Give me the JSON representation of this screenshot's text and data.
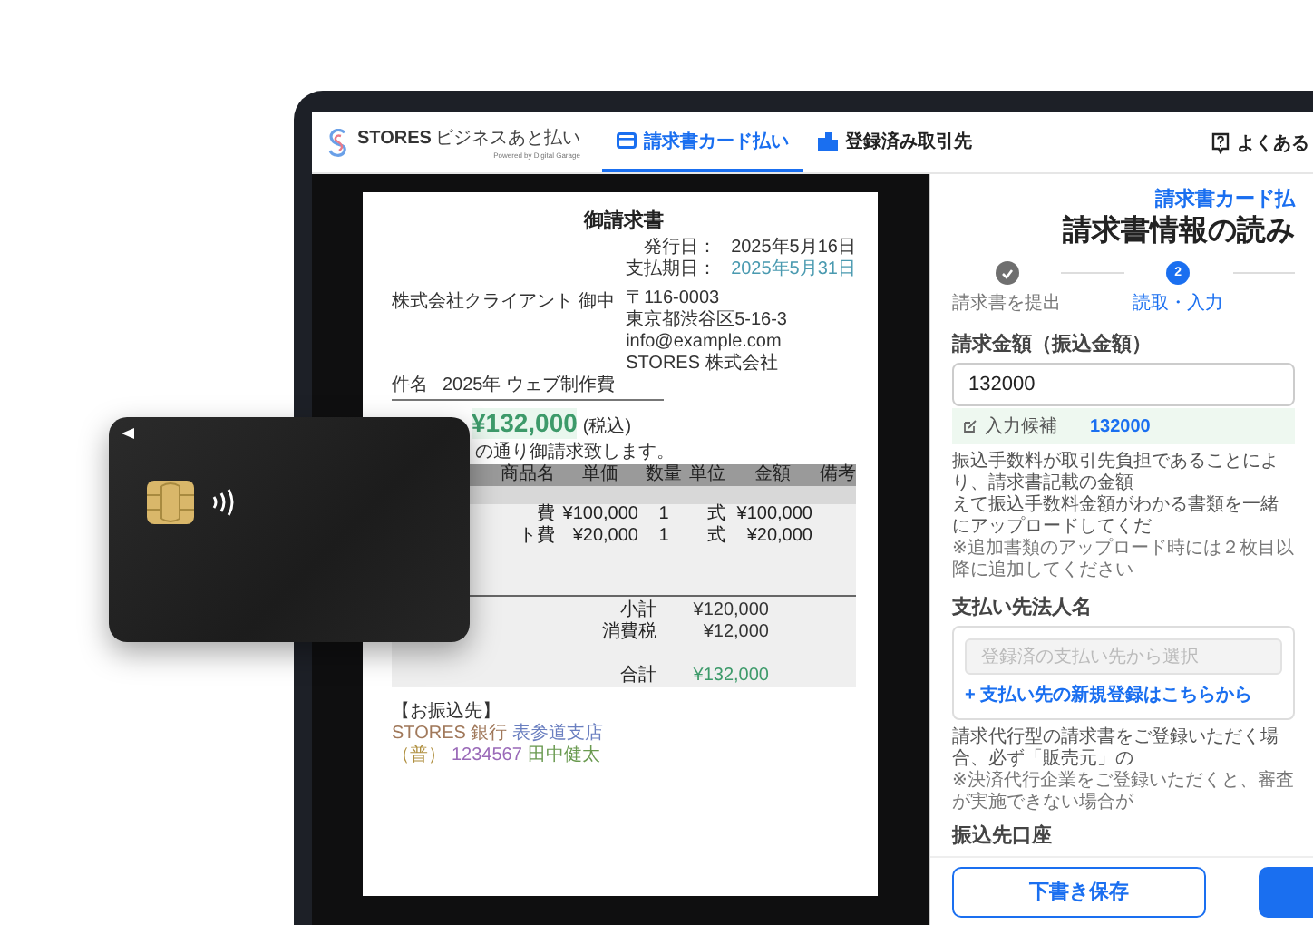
{
  "header": {
    "logo": {
      "brand": "STORES",
      "product": "ビジネスあと払い",
      "tagline": "Powered by Digital Garage"
    },
    "tabs": [
      {
        "label": "請求書カード払い",
        "kind": "card",
        "selected": true
      },
      {
        "label": "登録済み取引先",
        "kind": "building",
        "selected": false
      }
    ],
    "help": {
      "label": "よくある"
    }
  },
  "invoice": {
    "title": "御請求書",
    "dates": [
      {
        "label": "発行日：",
        "value": "2025年5月16日",
        "highlight": false
      },
      {
        "label": "支払期日：",
        "value": "2025年5月31日",
        "highlight": true
      }
    ],
    "client": "株式会社クライアント 御中",
    "sender": [
      "〒116-0003",
      "東京都渋谷区5-16-3",
      "info@example.com",
      "STORES 株式会社"
    ],
    "subject_label": "件名",
    "subject": "2025年 ウェブ制作費",
    "amount": "¥132,000",
    "amount_note": "(税込)",
    "intro": "の通り御請求致します。",
    "columns": [
      "商品名",
      "単価",
      "数量",
      "単位",
      "金額",
      "備考"
    ],
    "rows": [
      {
        "name": "費",
        "price": "¥100,000",
        "qty": "1",
        "unit": "式",
        "amount": "¥100,000"
      },
      {
        "name": "ト費",
        "price": "¥20,000",
        "qty": "1",
        "unit": "式",
        "amount": "¥20,000"
      }
    ],
    "totals": [
      {
        "label": "小計",
        "value": "¥120,000",
        "kind": "plain"
      },
      {
        "label": "消費税",
        "value": "¥12,000",
        "kind": "plain"
      },
      {
        "label": "合計",
        "value": "¥132,000",
        "kind": "total"
      }
    ],
    "bank": {
      "title": "【お振込先】",
      "lines": [
        [
          {
            "text": "STORES 銀行",
            "color": "#a0785a"
          },
          {
            "text": "表参道支店",
            "color": "#6a7fc0"
          }
        ],
        [
          {
            "text": "（普）",
            "color": "#b09040"
          },
          {
            "text": "1234567",
            "color": "#9a6ab8"
          },
          {
            "text": "田中健太",
            "color": "#6a9a50"
          }
        ]
      ]
    }
  },
  "form": {
    "subtitle": "請求書カード払",
    "title": "請求書情報の読み",
    "steps": [
      {
        "label": "請求書を提出",
        "kind": "done"
      },
      {
        "label": "読取・入力",
        "number": "2",
        "kind": "active"
      }
    ],
    "amount_field": {
      "label": "請求金額（振込金額）",
      "value": "132000"
    },
    "candidate": {
      "label": "入力候補",
      "value": "132000"
    },
    "amount_notes": [
      "振込手数料が取引先負担であることにより、請求書記載の金額",
      "えて振込手数料金額がわかる書類を一緒にアップロードしてくだ",
      "※追加書類のアップロード時には２枚目以降に追加してください"
    ],
    "payee_field": {
      "label": "支払い先法人名",
      "placeholder": "登録済の支払い先から選択",
      "link": "+ 支払い先の新規登録はこちらから"
    },
    "payee_notes": [
      "請求代行型の請求書をご登録いただく場合、必ず「販売元」の",
      "※決済代行企業をご登録いただくと、審査が実施できない場合が"
    ],
    "account_label": "振込先口座",
    "draft_button": "下書き保存"
  }
}
